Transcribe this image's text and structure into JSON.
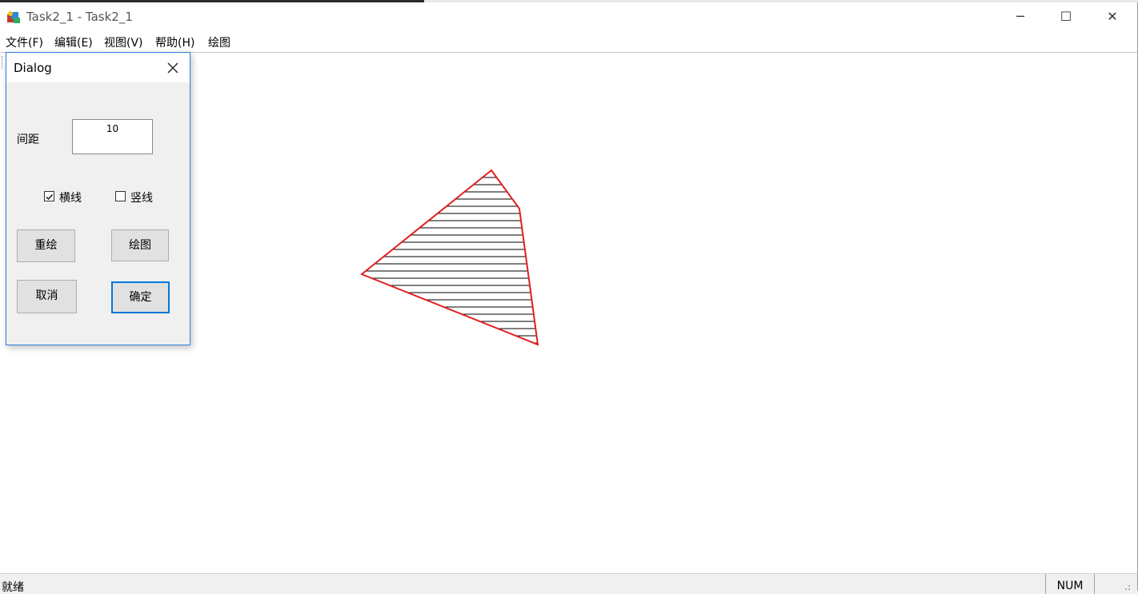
{
  "window": {
    "title": "Task2_1 - Task2_1",
    "controls": {
      "minimize": "─",
      "maximize": "☐",
      "close": "✕"
    }
  },
  "menu": [
    {
      "label": "文件(F)"
    },
    {
      "label": "编辑(E)"
    },
    {
      "label": "视图(V)"
    },
    {
      "label": "帮助(H)"
    },
    {
      "label": "绘图"
    }
  ],
  "dialog": {
    "title": "Dialog",
    "spacing_label": "间距",
    "spacing_value": "10",
    "horizontal": {
      "label": "横线",
      "checked": true
    },
    "vertical": {
      "label": "竖线",
      "checked": false
    },
    "buttons": {
      "redraw": "重绘",
      "draw": "绘图",
      "cancel": "取消",
      "ok": "确定"
    }
  },
  "status": {
    "text": "就绪",
    "num": "NUM"
  },
  "colors": {
    "polygon_stroke": "#e02020",
    "hatch": "#000000",
    "accent": "#0078d7"
  }
}
